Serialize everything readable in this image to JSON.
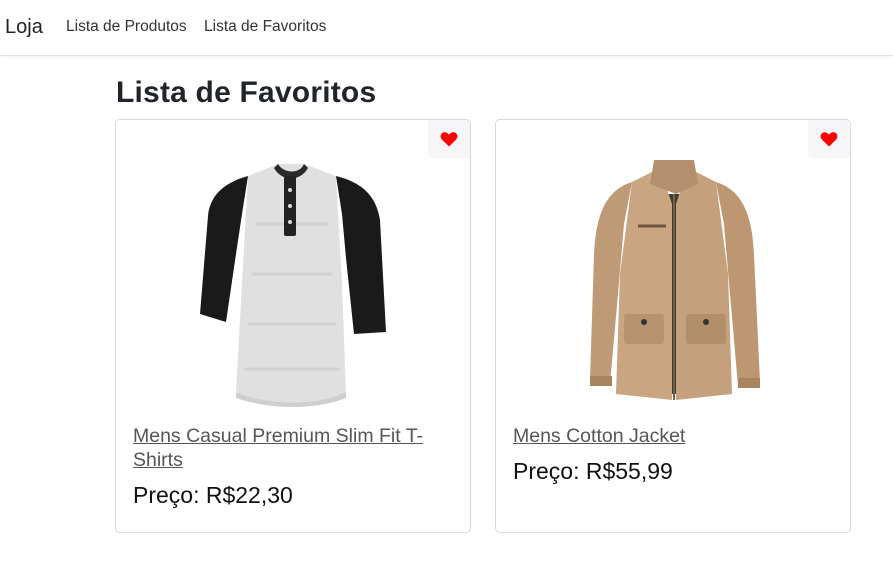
{
  "navbar": {
    "brand": "Loja",
    "links": [
      {
        "label": "Lista de Produtos"
      },
      {
        "label": "Lista de Favoritos"
      }
    ]
  },
  "page": {
    "title": "Lista de Favoritos"
  },
  "products": [
    {
      "name": "Mens Casual Premium Slim Fit T-Shirts",
      "price": "Preço: R$22,30",
      "favorite": true,
      "image": "raglan-henley-shirt"
    },
    {
      "name": "Mens Cotton Jacket",
      "price": "Preço: R$55,99",
      "favorite": true,
      "image": "khaki-cotton-jacket"
    }
  ],
  "colors": {
    "heart": "#ff0000",
    "link": "#555555"
  }
}
